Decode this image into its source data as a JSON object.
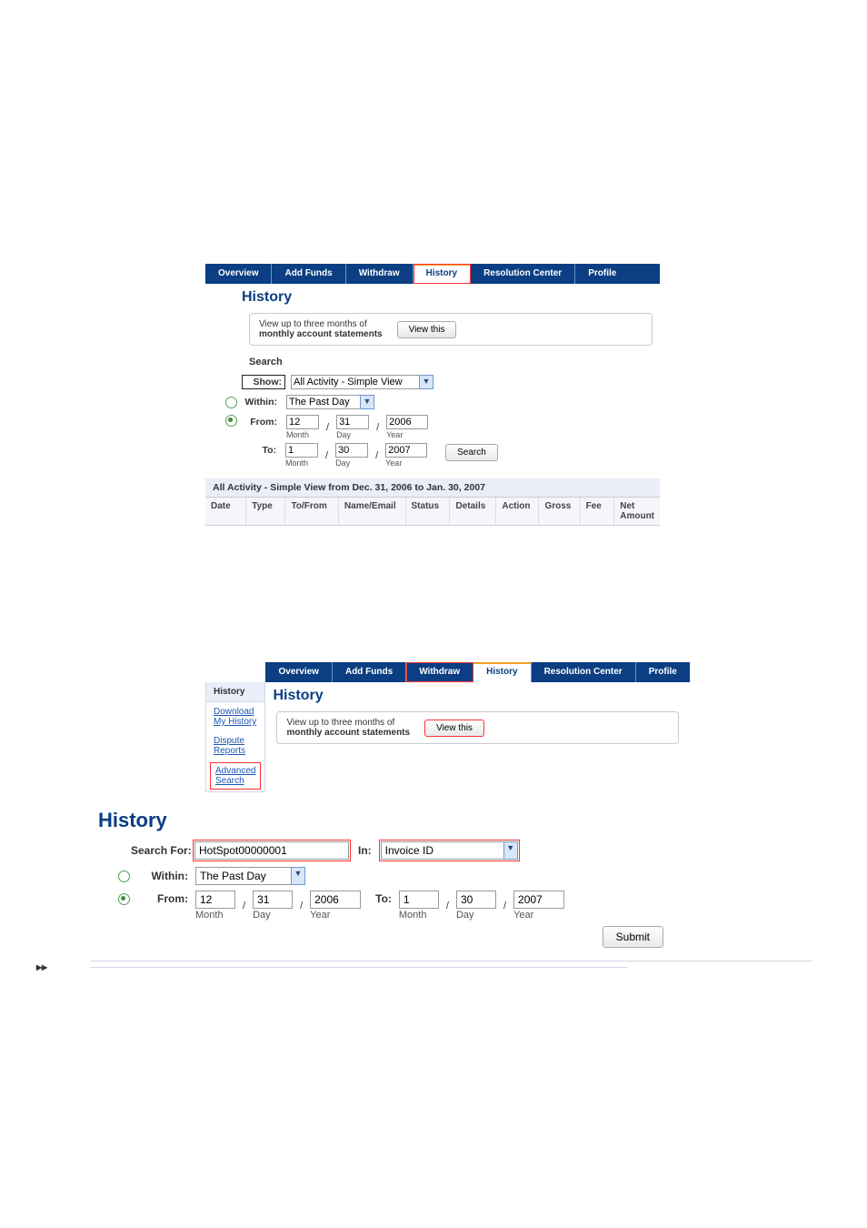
{
  "tabs": {
    "overview": "Overview",
    "addFunds": "Add Funds",
    "withdraw": "Withdraw",
    "history": "History",
    "resolution": "Resolution Center",
    "profile": "Profile"
  },
  "heading": "History",
  "stmt": {
    "text1": "View up to three months of",
    "text2": "monthly account statements",
    "btn": "View this"
  },
  "search1": {
    "sectionTitle": "Search",
    "show_lbl": "Show:",
    "show_val": "All Activity - Simple View",
    "within_lbl": "Within:",
    "within_val": "The Past Day",
    "from_lbl": "From:",
    "to_lbl": "To:",
    "from": {
      "m": "12",
      "d": "31",
      "y": "2006"
    },
    "to": {
      "m": "1",
      "d": "30",
      "y": "2007"
    },
    "sub_m": "Month",
    "sub_d": "Day",
    "sub_y": "Year",
    "searchBtn": "Search"
  },
  "results": {
    "title": "All Activity - Simple View from Dec. 31, 2006 to Jan. 30, 2007",
    "cols": [
      "Date",
      "Type",
      "To/From",
      "Name/Email",
      "Status",
      "Details",
      "Action",
      "Gross",
      "Fee",
      "Net Amount"
    ]
  },
  "leftmenu": {
    "hdr": "History",
    "download": "Download My History",
    "dispute": "Dispute Reports",
    "advanced": "Advanced Search"
  },
  "adv": {
    "searchFor_lbl": "Search For:",
    "searchFor_val": "HotSpot00000001",
    "in_lbl": "In:",
    "in_val": "Invoice ID",
    "within_lbl": "Within:",
    "within_val": "The Past Day",
    "from_lbl": "From:",
    "to_lbl": "To:",
    "from": {
      "m": "12",
      "d": "31",
      "y": "2006"
    },
    "to": {
      "m": "1",
      "d": "30",
      "y": "2007"
    },
    "sub_m": "Month",
    "sub_d": "Day",
    "sub_y": "Year",
    "submit": "Submit"
  },
  "expand": "▸▸"
}
